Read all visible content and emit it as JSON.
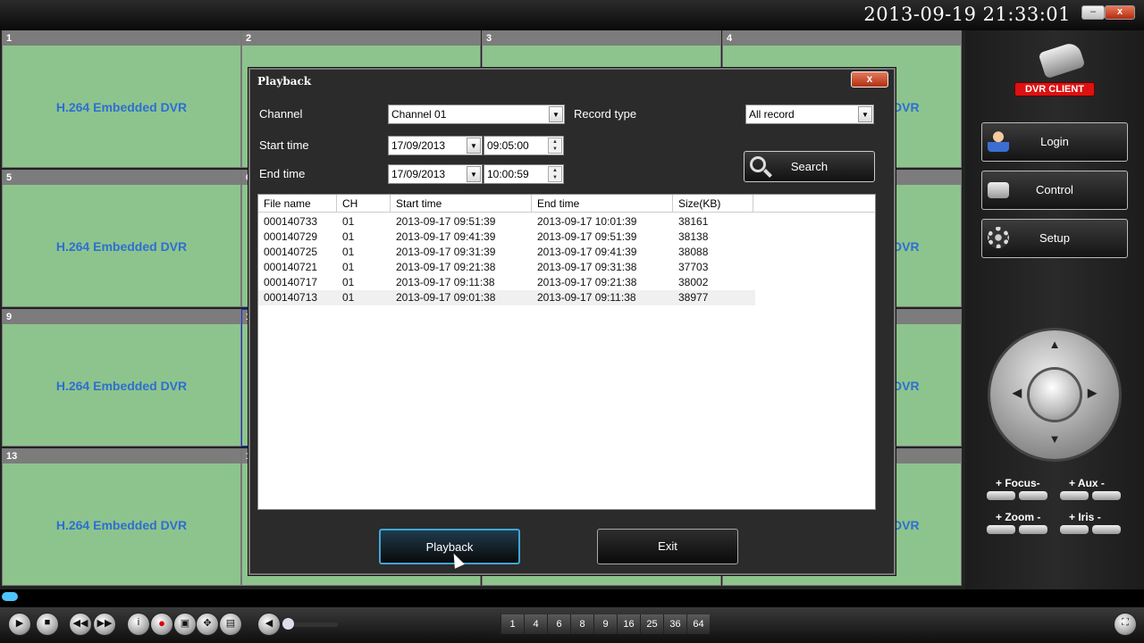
{
  "topbar": {
    "datetime": "2013-09-19  21:33:01",
    "minimize_icon": "minimize-icon",
    "close_icon": "close-icon",
    "minimize_glyph": "–",
    "close_glyph": "x"
  },
  "grid": {
    "cells": [
      {
        "num": "1",
        "label": "H.264 Embedded DVR"
      },
      {
        "num": "2",
        "label": ""
      },
      {
        "num": "3",
        "label": ""
      },
      {
        "num": "4",
        "label": "DVR"
      },
      {
        "num": "5",
        "label": "H.264 Embedded DVR"
      },
      {
        "num": "6",
        "label": ""
      },
      {
        "num": "",
        "label": ""
      },
      {
        "num": "",
        "label": "DVR"
      },
      {
        "num": "9",
        "label": "H.264 Embedded DVR"
      },
      {
        "num": "1",
        "label": ""
      },
      {
        "num": "",
        "label": ""
      },
      {
        "num": "",
        "label": "DVR"
      },
      {
        "num": "13",
        "label": "H.264 Embedded DVR"
      },
      {
        "num": "1",
        "label": ""
      },
      {
        "num": "",
        "label": ""
      },
      {
        "num": "",
        "label": "DVR"
      }
    ]
  },
  "right_panel": {
    "logo_text": "DVR CLIENT",
    "login": "Login",
    "control": "Control",
    "setup": "Setup",
    "ptz": {
      "up": "▲",
      "down": "▼",
      "left": "◀",
      "right": "▶"
    },
    "focus": "+ Focus-",
    "aux": "+ Aux  -",
    "zoom": "+ Zoom -",
    "iris": "+ Iris -"
  },
  "dialog": {
    "title": "Playback",
    "close": "x",
    "channel_label": "Channel",
    "channel_value": "Channel 01",
    "record_type_label": "Record type",
    "record_type_value": "All record",
    "start_time_label": "Start time",
    "start_date": "17/09/2013",
    "start_clock": "09:05:00",
    "end_time_label": "End time",
    "end_date": "17/09/2013",
    "end_clock": "10:00:59",
    "search": "Search",
    "columns": [
      "File name",
      "CH",
      "Start time",
      "End time",
      "Size(KB)"
    ],
    "rows": [
      [
        "000140733",
        "01",
        "2013-09-17 09:51:39",
        "2013-09-17 10:01:39",
        "38161"
      ],
      [
        "000140729",
        "01",
        "2013-09-17 09:41:39",
        "2013-09-17 09:51:39",
        "38138"
      ],
      [
        "000140725",
        "01",
        "2013-09-17 09:31:39",
        "2013-09-17 09:41:39",
        "38088"
      ],
      [
        "000140721",
        "01",
        "2013-09-17 09:21:38",
        "2013-09-17 09:31:38",
        "37703"
      ],
      [
        "000140717",
        "01",
        "2013-09-17 09:11:38",
        "2013-09-17 09:21:38",
        "38002"
      ],
      [
        "000140713",
        "01",
        "2013-09-17 09:01:38",
        "2013-09-17 09:11:38",
        "38977"
      ]
    ],
    "playback": "Playback",
    "exit": "Exit"
  },
  "bottombar": {
    "controls": {
      "play": "▶",
      "stop": "■",
      "rewind": "◀◀",
      "forward": "▶▶",
      "info": "i",
      "record": "●",
      "snapshot": "▣",
      "ptz": "✥",
      "split": "▤",
      "volume": "◀",
      "fullscreen": "⛶"
    },
    "splits": [
      "1",
      "4",
      "6",
      "8",
      "9",
      "16",
      "25",
      "36",
      "64"
    ]
  }
}
